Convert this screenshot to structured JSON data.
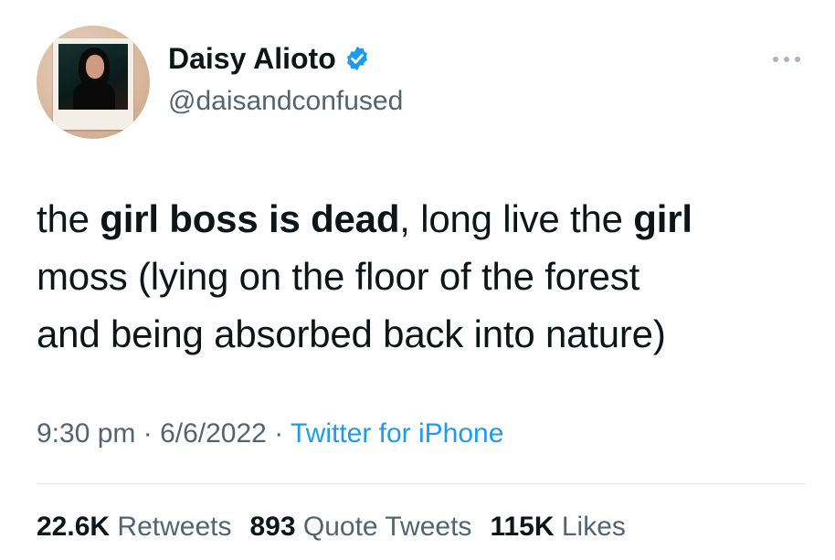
{
  "author": {
    "display_name": "Daisy Alioto",
    "handle": "@daisandconfused",
    "verified": true
  },
  "tweet": {
    "lines": [
      [
        {
          "text": "the ",
          "bold": false
        },
        {
          "text": "girl boss is dead",
          "bold": true
        },
        {
          "text": ", long live the ",
          "bold": false
        },
        {
          "text": "girl",
          "bold": true
        }
      ],
      [
        {
          "text": "moss (lying on the floor of the forest",
          "bold": false
        }
      ],
      [
        {
          "text": "and being absorbed back into nature)",
          "bold": false
        }
      ]
    ]
  },
  "meta": {
    "time": "9:30 pm",
    "separator": " · ",
    "date": "6/6/2022",
    "source": "Twitter for iPhone"
  },
  "stats": {
    "retweets_count": "22.6K",
    "retweets_label": "Retweets",
    "quotes_count": "893",
    "quotes_label": "Quote Tweets",
    "likes_count": "115K",
    "likes_label": "Likes"
  },
  "icons": {
    "verified": "verified-badge-icon",
    "more": "more-options-icon"
  },
  "colors": {
    "accent": "#1d9bf0",
    "text_primary": "#0f1419",
    "text_secondary": "#536471",
    "divider": "#e6e9eb"
  }
}
